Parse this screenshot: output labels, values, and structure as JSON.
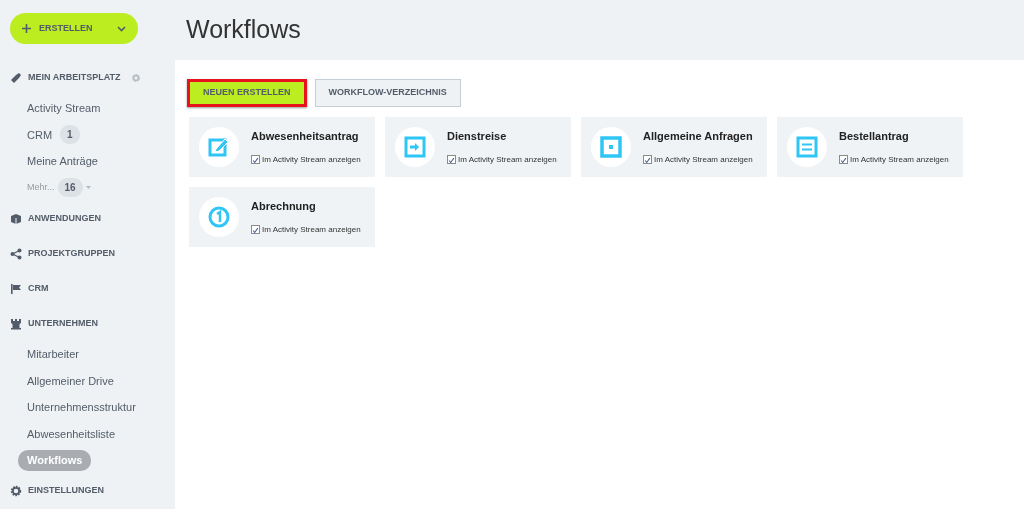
{
  "sidebar": {
    "create_button": {
      "label": "ERSTELLEN"
    },
    "sections": [
      {
        "kind": "workspace",
        "title": "MEIN ARBEITSPLATZ",
        "settings": true,
        "items": [
          {
            "label": "Activity Stream",
            "selected": false
          },
          {
            "label": "CRM",
            "count": "1",
            "selected": false
          },
          {
            "label": "Meine Anträge",
            "selected": false
          },
          {
            "label": "Mehr...",
            "count": "16",
            "more": true,
            "selected": false
          }
        ]
      },
      {
        "kind": "apps",
        "title": "ANWENDUNGEN"
      },
      {
        "kind": "groups",
        "title": "PROJEKTGRUPPEN"
      },
      {
        "kind": "crm",
        "title": "CRM"
      },
      {
        "kind": "company",
        "title": "UNTERNEHMEN",
        "items": [
          {
            "label": "Mitarbeiter",
            "selected": false
          },
          {
            "label": "Allgemeiner Drive",
            "selected": false
          },
          {
            "label": "Unternehmensstruktur",
            "selected": false
          },
          {
            "label": "Abwesenheitsliste",
            "selected": false
          },
          {
            "label": "Workflows",
            "selected": true
          }
        ]
      },
      {
        "kind": "settings",
        "title": "EINSTELLUNGEN"
      }
    ]
  },
  "page": {
    "title": "Workflows",
    "buttons": [
      {
        "label": "NEUEN ERSTELLEN",
        "kind": "primary",
        "highlighted": true
      },
      {
        "label": "WORKFLOW-VERZEICHNIS",
        "kind": "secondary",
        "highlighted": false
      }
    ],
    "workflows": [
      {
        "kind": "edit",
        "title": "Abwesenheitsantrag",
        "option": "Im Activity Stream anzeigen",
        "checked": true
      },
      {
        "kind": "arrow",
        "title": "Dienstreise",
        "option": "Im Activity Stream anzeigen",
        "checked": true
      },
      {
        "kind": "square",
        "title": "Allgemeine Anfragen",
        "option": "Im Activity Stream anzeigen",
        "checked": true
      },
      {
        "kind": "list",
        "title": "Bestellantrag",
        "option": "Im Activity Stream anzeigen",
        "checked": true
      },
      {
        "kind": "number",
        "title": "Abrechnung",
        "option": "Im Activity Stream anzeigen",
        "checked": true
      }
    ]
  }
}
